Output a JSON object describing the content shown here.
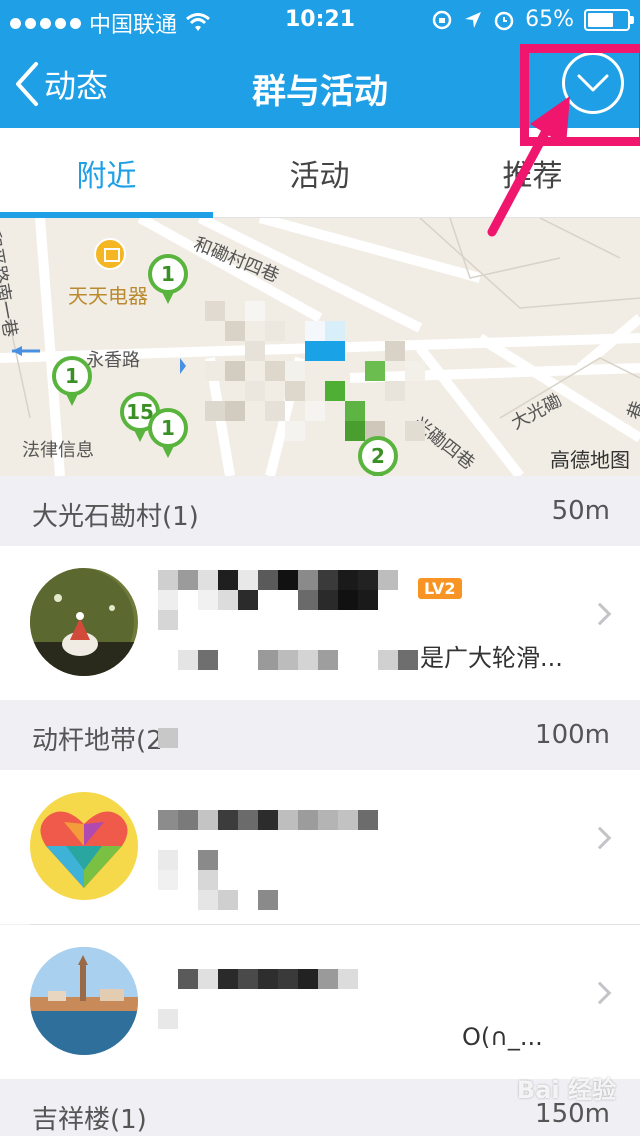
{
  "status_bar": {
    "carrier": "中国联通",
    "time": "10:21",
    "battery_percent": "65%",
    "battery_level": 0.65
  },
  "nav": {
    "back_label": "动态",
    "title": "群与活动"
  },
  "tabs": [
    {
      "label": "附近",
      "active": true
    },
    {
      "label": "活动",
      "active": false
    },
    {
      "label": "推荐",
      "active": false
    }
  ],
  "map": {
    "labels": {
      "road_left": "和平路南一巷",
      "road_top": "和磡村四巷",
      "road_xiang": "永香路",
      "shop": "天天电器",
      "info": "法律信息",
      "road_guang": "光磡四巷",
      "road_da": "大光磡",
      "road_right": "巷",
      "credit": "高德地图"
    },
    "pins": [
      "1",
      "1",
      "15",
      "1",
      "2"
    ]
  },
  "sections": [
    {
      "name": "大光石勘村(1)",
      "distance": "50m"
    },
    {
      "name": "动杆地带(2",
      "distance": "100m"
    },
    {
      "name": "吉祥楼(1)",
      "distance": "150m"
    }
  ],
  "rows": [
    {
      "badge": "LV2",
      "desc": "是广大轮滑..."
    },
    {
      "badge": "",
      "desc": ""
    },
    {
      "badge": "",
      "desc": "O(∩_..."
    }
  ],
  "watermark": "Bai 经验",
  "colors": {
    "primary": "#1e9fe6",
    "highlight": "#f0166e",
    "pin": "#58b43c",
    "badge": "#f79424"
  }
}
